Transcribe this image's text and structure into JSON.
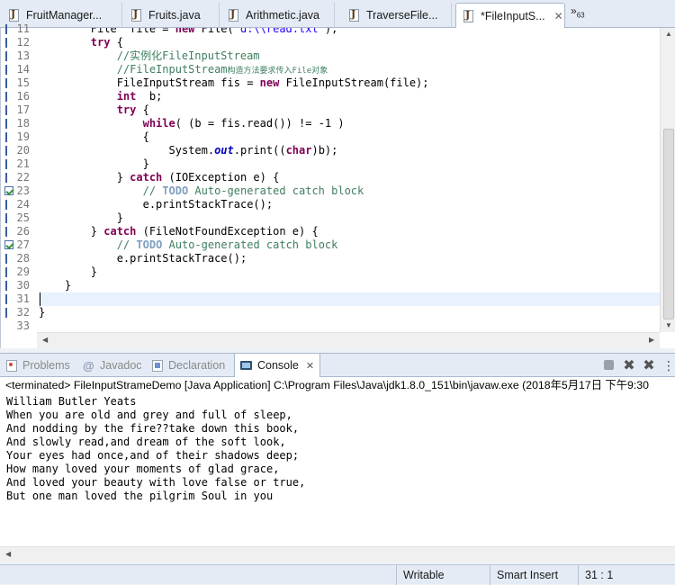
{
  "editor_tabs": [
    {
      "label": "FruitManager...",
      "active": false
    },
    {
      "label": "Fruits.java",
      "active": false
    },
    {
      "label": "Arithmetic.java",
      "active": false
    },
    {
      "label": "TraverseFile...",
      "active": false
    },
    {
      "label": "*FileInputS...",
      "active": true
    }
  ],
  "tab_overflow": {
    "glyph": "»",
    "count": "63"
  },
  "close_glyph": "✕",
  "code": {
    "line_numbers": [
      "11",
      "12",
      "13",
      "14",
      "15",
      "16",
      "17",
      "18",
      "19",
      "20",
      "21",
      "22",
      "23",
      "24",
      "25",
      "26",
      "27",
      "28",
      "29",
      "30",
      "31",
      "32",
      "33"
    ],
    "lines": {
      "l11_a": "        File  file = ",
      "l11_kw": "new",
      "l11_b": " File( ",
      "l11_str": "d:\\\\read.txt",
      "l11_c": " );",
      "l12_kw": "try",
      "l12_b": " {",
      "l13": "//实例化FileInputStream",
      "l14_a": "//FileInputStream",
      "l14_small": "构造方法要求传入File对象",
      "l15_a": "FileInputStream fis = ",
      "l15_kw": "new",
      "l15_b": " FileInputStream(file);",
      "l16_kw": "int",
      "l16_b": "  b;",
      "l17_kw": "try",
      "l17_b": " {",
      "l18_kw": "while",
      "l18_b": "( (b = fis.read()) != -1 )",
      "l19": "{",
      "l20_a": "System.",
      "l20_fld": "out",
      "l20_b": ".print((",
      "l20_kw": "char",
      "l20_c": ")b);",
      "l21": "}",
      "l22_a": "} ",
      "l22_kw": "catch",
      "l22_b": " (IOException e) {",
      "l23_a": "// ",
      "l23_todo": "TODO",
      "l23_b": " Auto-generated catch block",
      "l24": "e.printStackTrace();",
      "l25": "}",
      "l26_a": "} ",
      "l26_kw": "catch",
      "l26_b": " (FileNotFoundException e) {",
      "l27_a": "// ",
      "l27_todo": "TODO",
      "l27_b": " Auto-generated catch block",
      "l28": "e.printStackTrace();",
      "l29": "}",
      "l30": "}",
      "l32": "}"
    }
  },
  "view_tabs": [
    {
      "label": "Problems",
      "icon": "problems-icon",
      "active": false
    },
    {
      "label": "Javadoc",
      "icon": "javadoc-icon",
      "active": false
    },
    {
      "label": "Declaration",
      "icon": "declaration-icon",
      "active": false
    },
    {
      "label": "Console",
      "icon": "console-icon",
      "active": true
    }
  ],
  "console": {
    "header": "<terminated> FileInputStrameDemo [Java Application] C:\\Program Files\\Java\\jdk1.8.0_151\\bin\\javaw.exe (2018年5月17日 下午9:30",
    "output": [
      "William Butler Yeats",
      "When you are old and grey and full of sleep,",
      "And nodding by the fire??take down this book,",
      "And slowly read,and dream of the soft look,",
      "Your eyes had once,and of their shadows deep;",
      "How many loved your moments of glad grace,",
      "And loved your beauty with love false or true,",
      "But one man loved the pilgrim Soul in you"
    ]
  },
  "status": {
    "writable": "Writable",
    "insert_mode": "Smart Insert",
    "position": "31 : 1"
  },
  "colors": {
    "keyword": "#7f0055",
    "comment": "#3f7f5f",
    "string": "#2a00ff",
    "field": "#0000c0",
    "current_line": "#e8f2fe"
  }
}
